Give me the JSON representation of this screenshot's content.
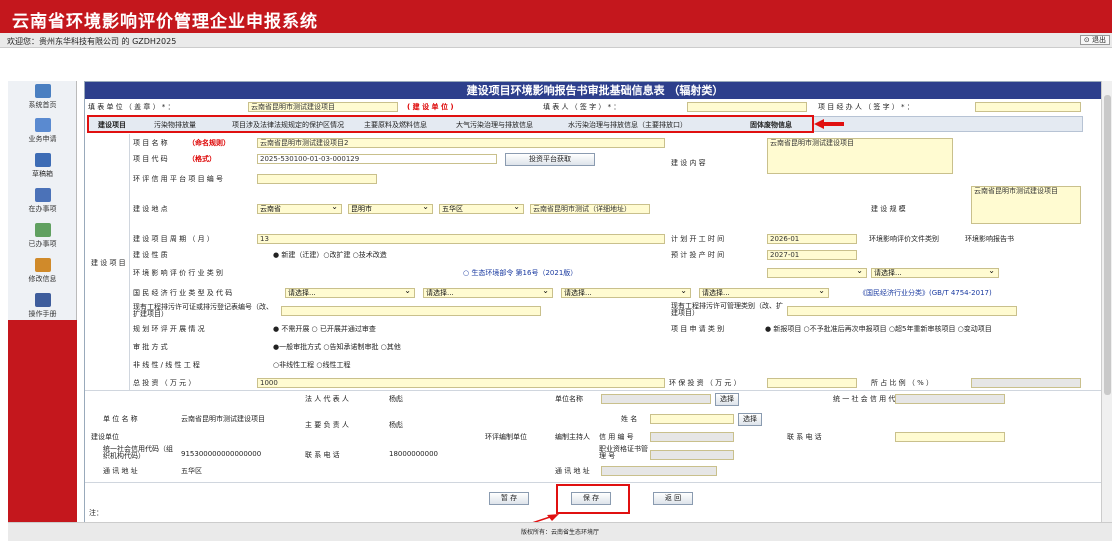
{
  "app": {
    "title": "云南省环境影响评价管理企业申报系统",
    "welcome": "欢迎您：贵州东华科技有限公司 的 GZDH2025",
    "exit": "⊙ 退出",
    "footer": "版权所有：云南省生态环境厅"
  },
  "sidebar": [
    {
      "label": "系统首页",
      "color": "#4a7fc1"
    },
    {
      "label": "业务申请",
      "color": "#5a8ad0"
    },
    {
      "label": "草稿箱",
      "color": "#3d6cb5"
    },
    {
      "label": "在办事项",
      "color": "#4b72b8"
    },
    {
      "label": "已办事项",
      "color": "#60a060"
    },
    {
      "label": "修改信息",
      "color": "#d08a2a"
    },
    {
      "label": "操作手册",
      "color": "#3e5d9c"
    }
  ],
  "form": {
    "title": "建设项目环境影响报告书审批基础信息表 （辐射类）",
    "fill_unit_label": "填 表 单 位 （ 盖 章 ） * ：",
    "fill_unit": "云南省昆明市测试建设项目",
    "build_unit_hint": "( 建 设 单 位 )",
    "filler_label": "填 表 人 （ 签 字 ） * ：",
    "handler_label": "项 目 经 办 人 （ 签 字 ） * ："
  },
  "tabs": [
    "建设项目",
    "污染物排放量",
    "项目涉及法律法规规定的保护区情况",
    "主要原料及燃料信息",
    "大气污染治理与排放信息",
    "水污染治理与排放信息（主要排放口）",
    "固体废物信息"
  ],
  "project": {
    "group": "建 设 项 目",
    "name_label": "项 目 名 称",
    "name_hint": "（命名规则）",
    "name": "云南省昆明市测试建设项目2",
    "code_label": "项 目 代 码",
    "code_hint": "（格式）",
    "code": "2025-530100-01-03-000129",
    "code_btn": "投资平台获取",
    "content_label": "建 设 内 容",
    "content": "云南省昆明市测试建设项目",
    "platform_label": "环 评 信 用 平 台 项 目 编 号",
    "location_label": "建 设 地 点",
    "province": "云南省",
    "city": "昆明市",
    "district": "五华区",
    "address": "云南省昆明市测试（详细地址）",
    "scale_label": "建 设 规 模",
    "scale": "云南省昆明市测试建设项目",
    "period_label": "建 设 项 目 周 期 （ 月 ）",
    "period": "13",
    "start_label": "计 划 开 工 时 间",
    "start": "2026-01",
    "doc_label": "环境影响评价文件类别",
    "doc": "环境影响报告书",
    "nature_label": "建 设 性 质",
    "nature_opts": "● 新建（迁建）○改扩建 ○技术改造",
    "prod_label": "预 计 投 产 时 间",
    "prod": "2027-01",
    "industry_label": "环 境 影 响 评 价 行 业 类 别",
    "industry_opt": "○ 生态环境部令 第16号（2021版）",
    "select": "请选择...",
    "econ_label": "国 民 经 济 行 业 类 型 及 代 码",
    "econ_link": "《国民经济行业分类》(GB/T 4754-2017)",
    "permit_label": "现有工程排污许可证或排污登记表编号（改、扩建项目）",
    "permit_type_label": "现有工程排污许可管理类别（改、扩建项目）",
    "plan_label": "规 划 环 评 开 展 情 况",
    "plan_opts": "● 不需开展 ○ 已开展并通过审查",
    "apply_label": "项 目 申 请 类 别",
    "apply_opts": "● 新报项目 ○不予批准后再次申报项目 ○超5年重新审核项目 ○变动项目",
    "approve_label": "审 批 方 式",
    "approve_opts": "●一般审批方式 ○告知承诺制审批 ○其他",
    "linear_label": "非 线 性 / 线 性 工 程",
    "linear_opts": "○非线性工程 ○线性工程",
    "total_label": "总 投 资 （ 万 元 ）",
    "total": "1000",
    "env_label": "环 保 投 资 （ 万 元 ）",
    "ratio_label": "所 占 比 例 （ % ）"
  },
  "unit": {
    "group": "建设单位",
    "name_label": "单 位 名 称",
    "name": "云南省昆明市测试建设项目",
    "legal_label": "法 人 代 表 人",
    "legal": "杨彪",
    "resp_label": "主 要 负 责 人",
    "resp": "杨彪",
    "credit_label": "统一社会信用代码（组织机构代码）",
    "credit": "915300000000000000",
    "phone_label": "联 系 电 话",
    "phone": "18000000000",
    "addr_label": "通 讯 地 址",
    "addr": "五华区",
    "org_group": "环评编制单位",
    "org_name_label": "单位名称",
    "pick": "选择",
    "org_credit_label": "统 一 社 会 信 用 代 码",
    "host_label": "编制主持人",
    "host_name_label": "姓 名",
    "host_no_label": "信 用 编 号",
    "host_cert_label": "职业资格证书管 理 号",
    "org_phone_label": "联 系 电 话",
    "org_addr_label": "通 讯 地 址"
  },
  "buttons": {
    "draft": "暂 存",
    "save": "保 存",
    "back": "返 回"
  },
  "note": "注："
}
